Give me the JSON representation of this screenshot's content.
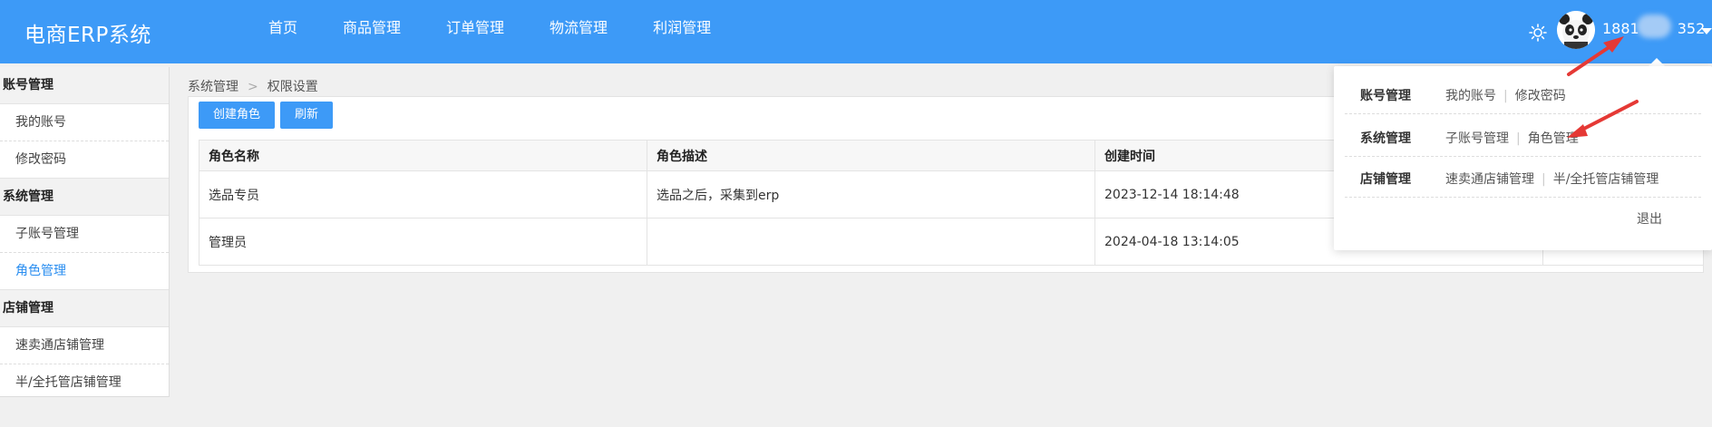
{
  "header": {
    "brand": "电商ERP系统",
    "nav": [
      "首页",
      "商品管理",
      "订单管理",
      "物流管理",
      "利润管理"
    ],
    "user": {
      "name_prefix": "1881",
      "name_suffix": "352"
    }
  },
  "sidebar": {
    "groups": [
      {
        "title": "账号管理",
        "items": [
          "我的账号",
          "修改密码"
        ]
      },
      {
        "title": "系统管理",
        "items": [
          "子账号管理",
          "角色管理"
        ]
      },
      {
        "title": "店铺管理",
        "items": [
          "速卖通店铺管理",
          "半/全托管店铺管理"
        ]
      }
    ],
    "active": "角色管理"
  },
  "breadcrumb": [
    "系统管理",
    "权限设置"
  ],
  "toolbar": {
    "create": "创建角色",
    "refresh": "刷新"
  },
  "table": {
    "headers": [
      "角色名称",
      "角色描述",
      "创建时间",
      ""
    ],
    "rows": [
      [
        "选品专员",
        "选品之后，采集到erp",
        "2023-12-14 18:14:48",
        ""
      ],
      [
        "管理员",
        "",
        "2024-04-18 13:14:05",
        ""
      ]
    ]
  },
  "dropdown": {
    "rows": [
      {
        "label": "账号管理",
        "links": [
          "我的账号",
          "修改密码"
        ]
      },
      {
        "label": "系统管理",
        "links": [
          "子账号管理",
          "角色管理"
        ]
      },
      {
        "label": "店铺管理",
        "links": [
          "速卖通店铺管理",
          "半/全托管店铺管理"
        ]
      }
    ],
    "logout": "退出"
  },
  "colors": {
    "primary": "#3d9af7",
    "active": "#2a8ef0",
    "annotation": "#e53935"
  },
  "icons": [
    "sun-icon",
    "avatar",
    "caret-down-icon",
    "breadcrumb-separator-icon"
  ]
}
